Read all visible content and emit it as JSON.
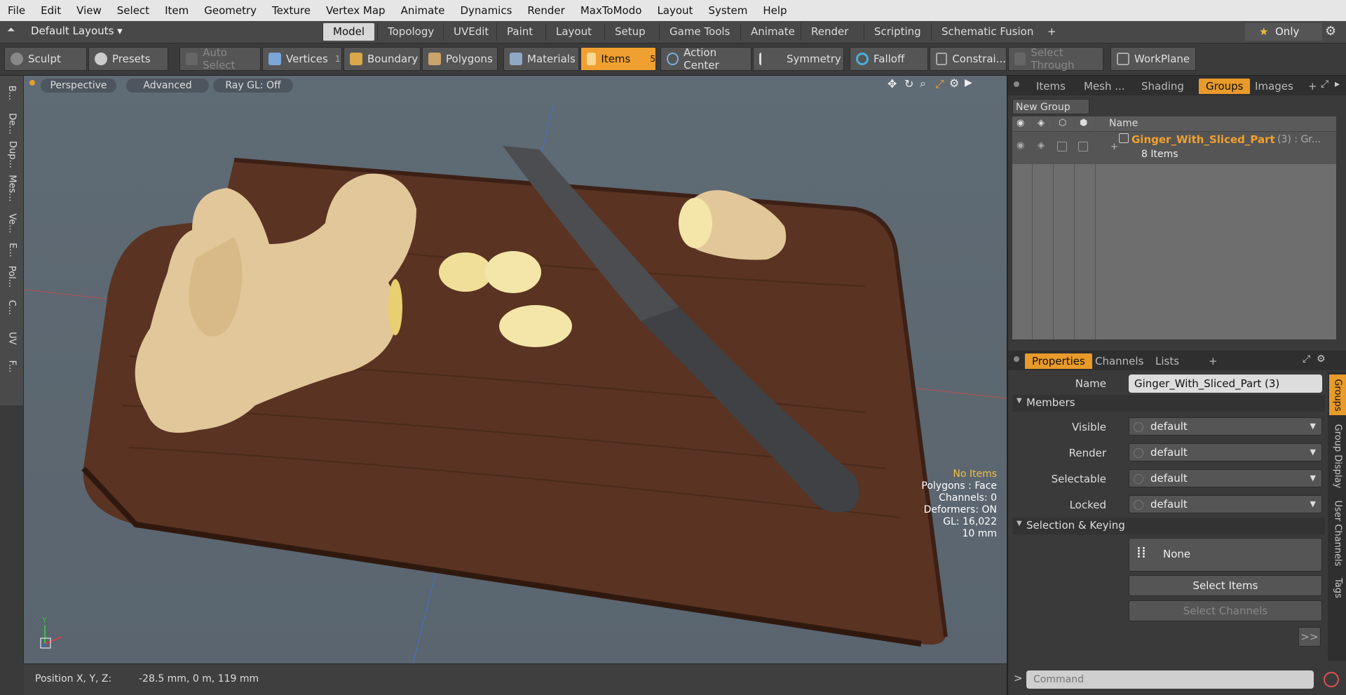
{
  "menu": [
    "File",
    "Edit",
    "View",
    "Select",
    "Item",
    "Geometry",
    "Texture",
    "Vertex Map",
    "Animate",
    "Dynamics",
    "Render",
    "MaxToModo",
    "Layout",
    "System",
    "Help"
  ],
  "layout": {
    "layout_name": "Default Layouts",
    "tabs": [
      "Model",
      "Topology",
      "UVEdit",
      "Paint",
      "Layout",
      "Setup",
      "Game Tools",
      "Animate",
      "Render",
      "Scripting",
      "Schematic Fusion"
    ],
    "active_tab": "Model",
    "plus": "+",
    "only": "Only"
  },
  "tools": {
    "sculpt": "Sculpt",
    "presets": "Presets",
    "auto_select": "Auto Select",
    "vertices": "Vertices",
    "vertices_count": "1",
    "boundary": "Boundary",
    "polygons": "Polygons",
    "materials": "Materials",
    "items": "Items",
    "items_count": "5",
    "action_center": "Action Center",
    "symmetry": "Symmetry",
    "falloff": "Falloff",
    "constraints": "Constrai...",
    "select_through": "Select Through",
    "workplane": "WorkPlane"
  },
  "leftstrip": [
    "B...",
    "De...",
    "Dup...",
    "Mes...",
    "Ve...",
    "E...",
    "Pol...",
    "C...",
    "UV",
    "F..."
  ],
  "viewport": {
    "perspective": "Perspective",
    "advanced": "Advanced",
    "raygl": "Ray GL: Off",
    "hud": {
      "no_items": "No Items",
      "polygons": "Polygons : Face",
      "channels": "Channels: 0",
      "deformers": "Deformers: ON",
      "gl": "GL: 16,022",
      "unit": "10 mm"
    },
    "axis_y": "Y"
  },
  "status": {
    "position_label": "Position X, Y, Z:",
    "position_value": "-28.5 mm, 0 m, 119 mm"
  },
  "groups_panel": {
    "tabs": [
      "Items",
      "Mesh ...",
      "Shading",
      "Groups",
      "Images"
    ],
    "active_tab": "Groups",
    "plus": "+",
    "new_group": "New Group",
    "column_name": "Name",
    "item_name": "Ginger_With_Sliced_Part",
    "item_suffix": "(3) : Gr...",
    "item_count": "8 Items"
  },
  "properties": {
    "tabs": [
      "Properties",
      "Channels",
      "Lists"
    ],
    "active_tab": "Properties",
    "plus": "+",
    "name_label": "Name",
    "name_value": "Ginger_With_Sliced_Part (3)",
    "members_section": "Members",
    "visible_label": "Visible",
    "visible_value": "default",
    "render_label": "Render",
    "render_value": "default",
    "selectable_label": "Selectable",
    "selectable_value": "default",
    "locked_label": "Locked",
    "locked_value": "default",
    "selkey_section": "Selection & Keying",
    "none_label": "None",
    "select_items": "Select Items",
    "select_channels": "Select Channels",
    "more": ">>",
    "side_tabs": [
      "Groups",
      "Group Display",
      "User Channels",
      "Tags"
    ]
  },
  "command": {
    "prompt": ">",
    "placeholder": "Command"
  },
  "colors": {
    "accent": "#f0a030",
    "viewport_bg": "#5f6b75",
    "board": "#5a3322",
    "ginger": "#e2c79a",
    "knife": "#4b4d50"
  }
}
